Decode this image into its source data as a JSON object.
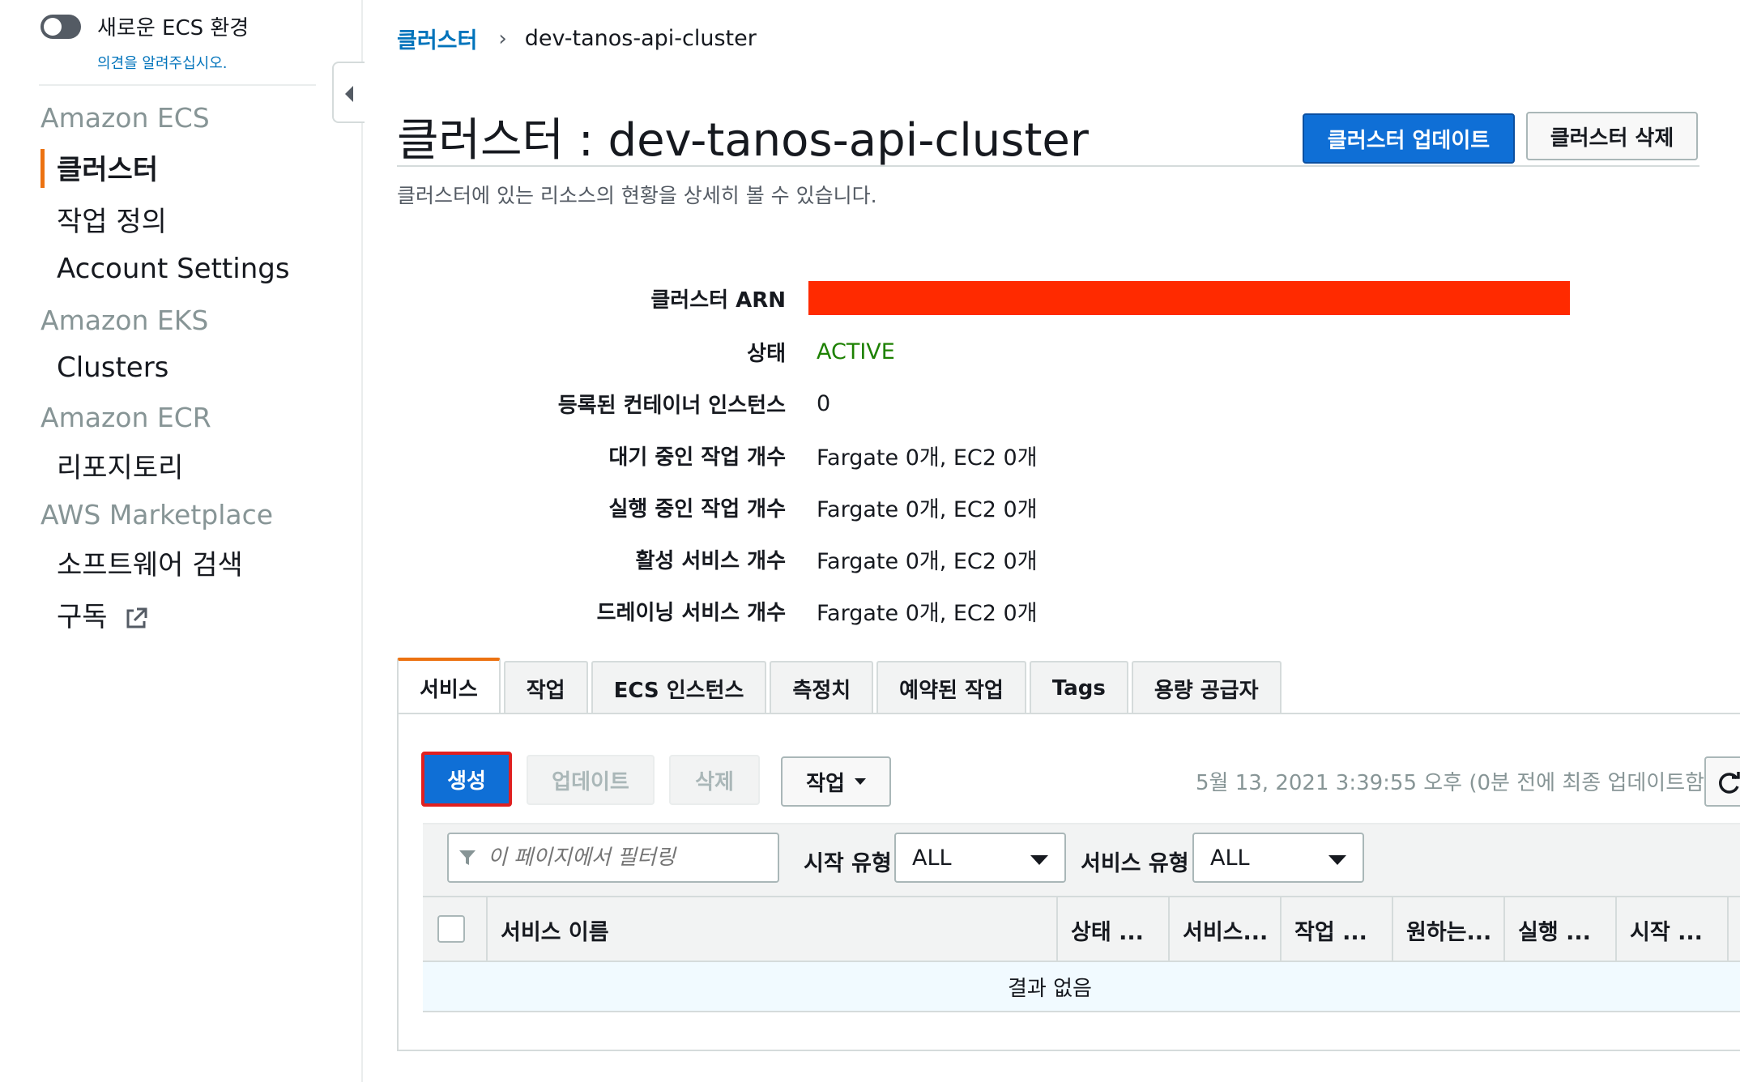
{
  "sidebar": {
    "toggle_label": "새로운 ECS 환경",
    "feedback_link": "의견을 알려주십시오.",
    "sections": [
      {
        "title": "Amazon ECS",
        "items": [
          "클러스터",
          "작업 정의",
          "Account Settings"
        ]
      },
      {
        "title": "Amazon EKS",
        "items": [
          "Clusters"
        ]
      },
      {
        "title": "Amazon ECR",
        "items": [
          "리포지토리"
        ]
      },
      {
        "title": "AWS Marketplace",
        "items": [
          "소프트웨어 검색",
          "구독"
        ]
      }
    ],
    "active_item": "클러스터",
    "external_icon": "external-link-icon"
  },
  "breadcrumb": {
    "parent": "클러스터",
    "separator": "›",
    "current": "dev-tanos-api-cluster"
  },
  "header": {
    "title": "클러스터 : dev-tanos-api-cluster",
    "subtitle": "클러스터에 있는 리소스의 현황을 상세히 볼 수 있습니다.",
    "update_button": "클러스터 업데이트",
    "delete_button": "클러스터 삭제"
  },
  "details": [
    {
      "label": "클러스터 ARN",
      "value": ""
    },
    {
      "label": "상태",
      "value": "ACTIVE"
    },
    {
      "label": "등록된 컨테이너 인스턴스",
      "value": "0"
    },
    {
      "label": "대기 중인 작업 개수",
      "value": "Fargate 0개, EC2 0개"
    },
    {
      "label": "실행 중인 작업 개수",
      "value": "Fargate 0개, EC2 0개"
    },
    {
      "label": "활성 서비스 개수",
      "value": "Fargate 0개, EC2 0개"
    },
    {
      "label": "드레이닝 서비스 개수",
      "value": "Fargate 0개, EC2 0개"
    }
  ],
  "tabs": [
    "서비스",
    "작업",
    "ECS 인스턴스",
    "측정치",
    "예약된 작업",
    "Tags",
    "용량 공급자"
  ],
  "active_tab": "서비스",
  "toolbar": {
    "create": "생성",
    "update": "업데이트",
    "delete": "삭제",
    "actions": "작업",
    "last_updated": "5월 13, 2021 3:39:55 오후 (0분 전에 최종 업데이트함"
  },
  "filters": {
    "placeholder": "이 페이지에서 필터링",
    "launch_type_label": "시작 유형",
    "launch_type_value": "ALL",
    "service_type_label": "서비스 유형",
    "service_type_value": "ALL"
  },
  "table": {
    "columns": [
      "서비스 이름",
      "상태 ...",
      "서비스...",
      "작업 ...",
      "원하는...",
      "실행 ...",
      "시작 ..."
    ],
    "empty_message": "결과 없음"
  },
  "colors": {
    "primary": "#0f6fd6",
    "accent": "#ec7211",
    "status_active": "#1d8102",
    "redaction": "#ff2a00"
  }
}
